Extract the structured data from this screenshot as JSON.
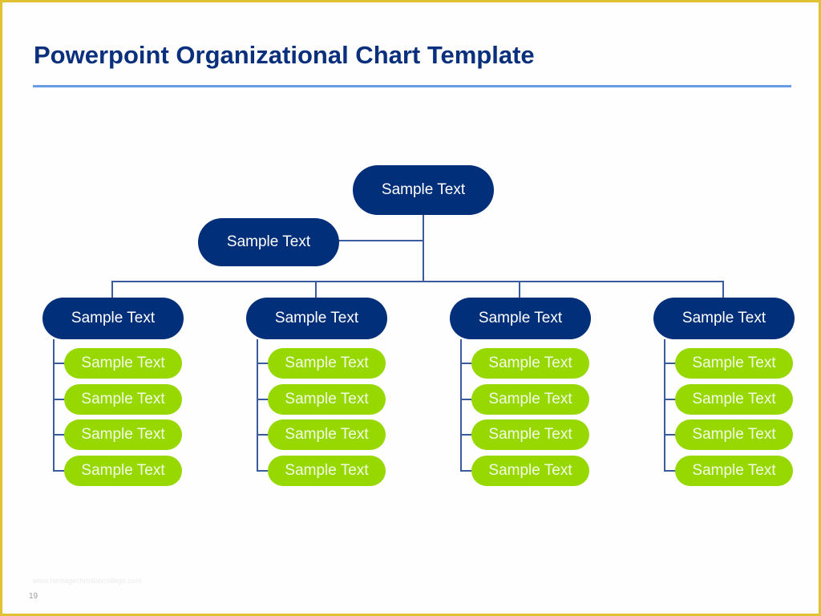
{
  "slide": {
    "title": "Powerpoint Organizational Chart Template",
    "footer_url": "www.heritagechristiancollege.com",
    "page_number": "19"
  },
  "colors": {
    "title": "#0a2f7c",
    "rule": "#6b9be6",
    "border": "#e0c232",
    "dark_node": "#022f7a",
    "green_node": "#96d800",
    "connector": "#3a5c9c"
  },
  "org_chart": {
    "root": {
      "label": "Sample Text"
    },
    "assistant": {
      "label": "Sample Text"
    },
    "departments": [
      {
        "label": "Sample Text",
        "members": [
          "Sample Text",
          "Sample Text",
          "Sample Text",
          "Sample Text"
        ]
      },
      {
        "label": "Sample Text",
        "members": [
          "Sample Text",
          "Sample Text",
          "Sample Text",
          "Sample Text"
        ]
      },
      {
        "label": "Sample Text",
        "members": [
          "Sample Text",
          "Sample Text",
          "Sample Text",
          "Sample Text"
        ]
      },
      {
        "label": "Sample Text",
        "members": [
          "Sample Text",
          "Sample Text",
          "Sample Text",
          "Sample Text"
        ]
      }
    ]
  }
}
